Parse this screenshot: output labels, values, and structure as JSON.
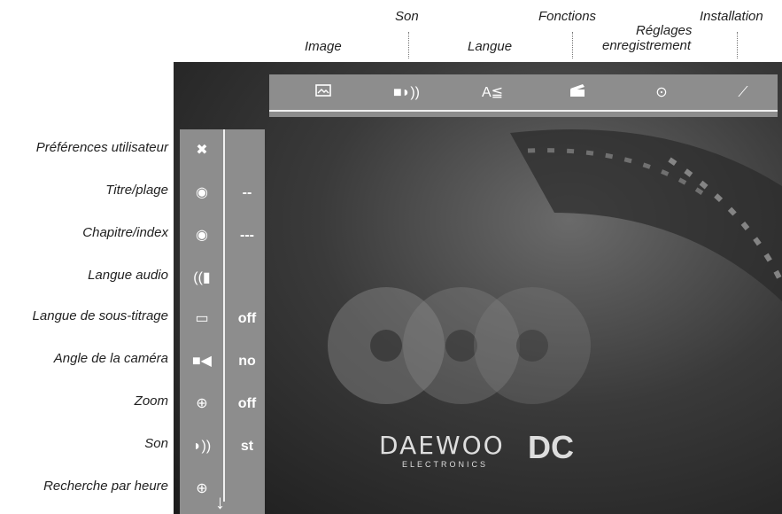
{
  "top_captions": {
    "image": "Image",
    "son": "Son",
    "langue": "Langue",
    "fonctions": "Fonctions",
    "reglages_line1": "Réglages",
    "reglages_line2": "enregistrement",
    "installation": "Installation"
  },
  "top_menu_icons": [
    "picture-icon",
    "speaker-icon",
    "language-icon",
    "clapperboard-icon",
    "record-disc-icon",
    "wrench-icon"
  ],
  "side_items": [
    {
      "label": "Préférences utilisateur",
      "icon": "tools-icon",
      "value": ""
    },
    {
      "label": "Titre/plage",
      "icon": "title-disc-icon",
      "value": "--"
    },
    {
      "label": "Chapitre/index",
      "icon": "chapter-disc-icon",
      "value": "---"
    },
    {
      "label": "Langue audio",
      "icon": "audio-language-icon",
      "value": ""
    },
    {
      "label": "Langue de sous-titrage",
      "icon": "subtitle-icon",
      "value": "off"
    },
    {
      "label": "Angle de la caméra",
      "icon": "camera-icon",
      "value": "no"
    },
    {
      "label": "Zoom",
      "icon": "zoom-icon",
      "value": "off"
    },
    {
      "label": "Son",
      "icon": "speaker-icon",
      "value": "st"
    },
    {
      "label": "Recherche par heure",
      "icon": "time-search-icon",
      "value": ""
    }
  ],
  "logo": {
    "brand": "DAEWOO",
    "sub": "ELECTRONICS",
    "mark": "DC"
  }
}
